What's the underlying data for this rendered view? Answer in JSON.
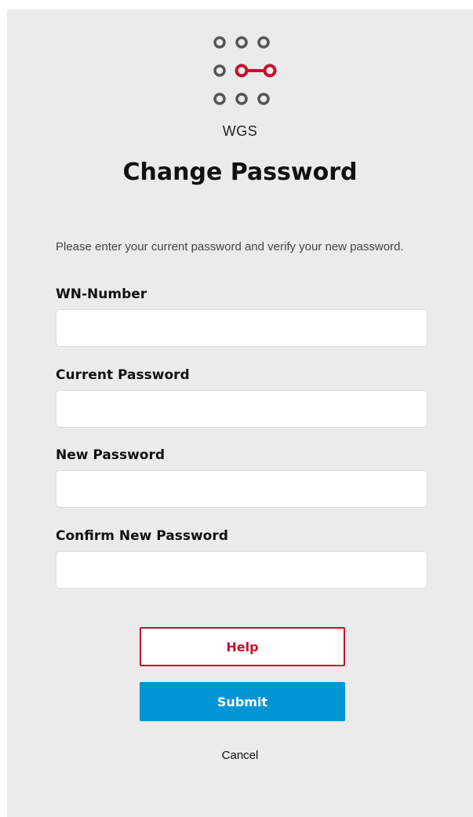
{
  "logo": {
    "icon": "wgs-dots-logo-icon",
    "text": "WGS",
    "colors": {
      "dot": "#555555",
      "accent": "#c8102e"
    }
  },
  "title": "Change Password",
  "intro": "Please enter your current password and verify your new password.",
  "fields": [
    {
      "label": "WN-Number",
      "value": "",
      "placeholder": ""
    },
    {
      "label": "Current Password",
      "value": "",
      "placeholder": ""
    },
    {
      "label": "New Password",
      "value": "",
      "placeholder": ""
    },
    {
      "label": "Confirm New Password",
      "value": "",
      "placeholder": ""
    }
  ],
  "buttons": {
    "help": "Help",
    "submit": "Submit",
    "cancel": "Cancel"
  },
  "colors": {
    "panel": "#ebebeb",
    "help": "#c8102e",
    "submit": "#0096d6"
  }
}
